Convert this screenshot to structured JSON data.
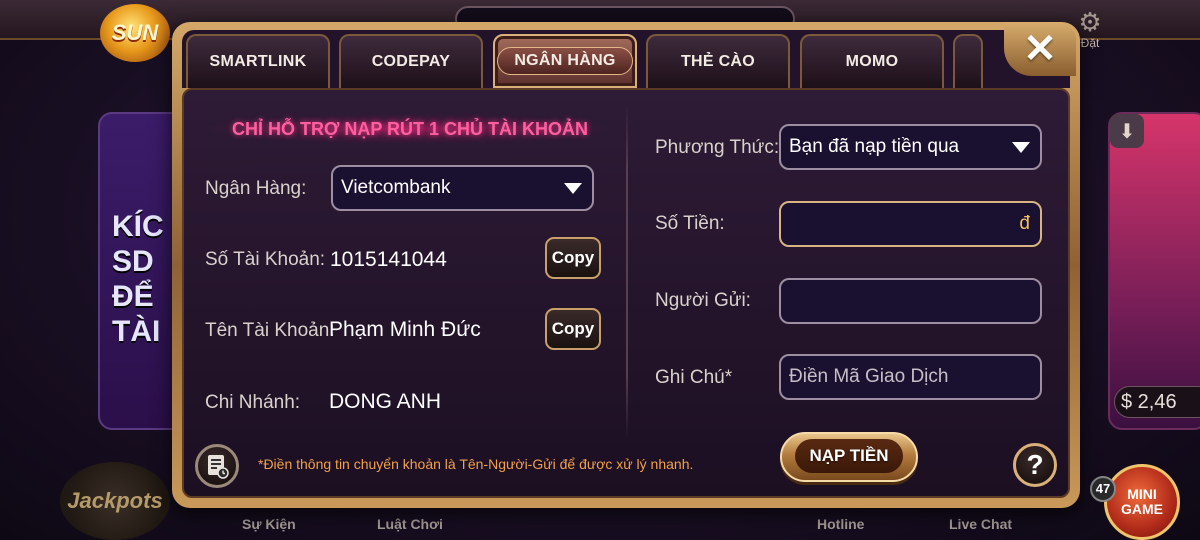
{
  "background": {
    "logo_text": "SUN",
    "settings_label": "Đặt",
    "card_left_text": "KÍC\nSD\nĐỂ\nTÀI",
    "balance_text": "$ 2,46",
    "jackpot_text": "Jackpots",
    "minigame_text": "MINI\nGAME",
    "minigame_badge": "47",
    "bottom_nav": {
      "su_kien": "Sự Kiện",
      "luat_choi": "Luật Chơi",
      "hotline": "Hotline",
      "live_chat": "Live Chat"
    }
  },
  "tabs": [
    {
      "label": "SMARTLINK",
      "active": false
    },
    {
      "label": "CODEPAY",
      "active": false
    },
    {
      "label": "NGÂN HÀNG",
      "active": true
    },
    {
      "label": "THẺ CÀO",
      "active": false
    },
    {
      "label": "MOMO",
      "active": false
    }
  ],
  "close_label": "✕",
  "notice": "CHỈ HỖ TRỢ NẠP RÚT 1 CHỦ TÀI KHOẢN",
  "left": {
    "bank_label": "Ngân Hàng:",
    "bank_value": "Vietcombank",
    "account_no_label": "Số Tài Khoản:",
    "account_no_value": "1015141044",
    "account_name_label": "Tên Tài Khoản:",
    "account_name_value": "Phạm Minh Đức",
    "branch_label": "Chi Nhánh:",
    "branch_value": "DONG ANH",
    "copy_label": "Copy"
  },
  "right": {
    "method_label": "Phương Thức:",
    "method_value": "Bạn đã nạp tiền qua",
    "amount_label": "Số Tiền:",
    "amount_value": "",
    "amount_unit": "đ",
    "sender_label": "Người Gửi:",
    "sender_value": "",
    "note_label": "Ghi Chú*",
    "note_placeholder": "Điền Mã Giao Dịch"
  },
  "submit_label": "NẠP TIỀN",
  "help_label": "?",
  "footnote": "*Điền thông tin chuyển khoản là Tên-Người-Gửi để được xử lý nhanh.",
  "colors": {
    "notice": "#ff5fa0",
    "footnote": "#f0a04a",
    "gold_border": "#d9b07a",
    "panel_bg": "#2e1b36"
  }
}
